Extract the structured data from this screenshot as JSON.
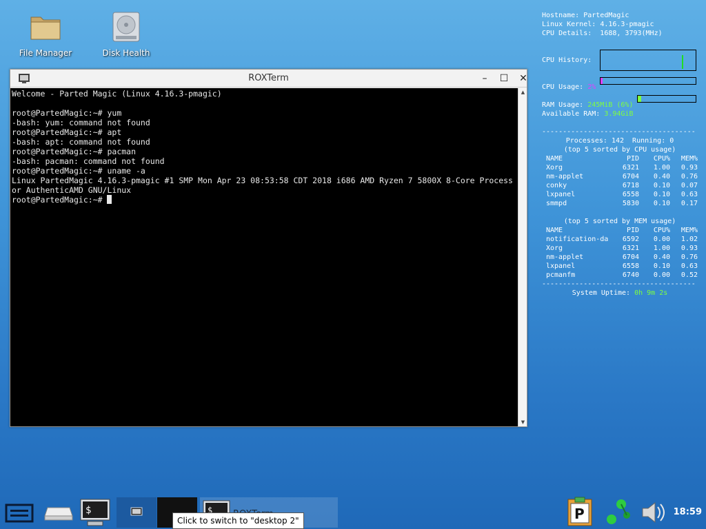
{
  "desktop_icons": [
    {
      "label": "File Manager"
    },
    {
      "label": "Disk Health"
    }
  ],
  "conky": {
    "hostname_label": "Hostname:",
    "hostname": "PartedMagic",
    "kernel_label": "Linux Kernel:",
    "kernel": "4.16.3-pmagic",
    "cpu_details_label": "CPU Details:",
    "cpu_details": "1688, 3793(MHz)",
    "cpu_history_label": "CPU History:",
    "cpu_usage_label": "CPU Usage:",
    "cpu_usage": "2%",
    "cpu_usage_fraction": 0.02,
    "ram_usage_label": "RAM Usage:",
    "ram_usage": "245MiB (6%)",
    "ram_usage_fraction": 0.06,
    "available_ram_label": "Available RAM:",
    "available_ram": "3.94GiB",
    "separator": "-------------------------------------",
    "processes_line": "Processes: 142  Running: 0",
    "cpu_sort_heading": "(top 5 sorted by CPU usage)",
    "mem_sort_heading": "(top 5 sorted by MEM usage)",
    "columns": [
      "NAME",
      "PID",
      "CPU%",
      "MEM%"
    ],
    "cpu_top": [
      [
        "Xorg",
        "6321",
        "1.00",
        "0.93"
      ],
      [
        "nm-applet",
        "6704",
        "0.40",
        "0.76"
      ],
      [
        "conky",
        "6718",
        "0.10",
        "0.07"
      ],
      [
        "lxpanel",
        "6558",
        "0.10",
        "0.63"
      ],
      [
        "smmpd",
        "5830",
        "0.10",
        "0.17"
      ]
    ],
    "mem_top": [
      [
        "notification-da",
        "6592",
        "0.00",
        "1.02"
      ],
      [
        "Xorg",
        "6321",
        "1.00",
        "0.93"
      ],
      [
        "nm-applet",
        "6704",
        "0.40",
        "0.76"
      ],
      [
        "lxpanel",
        "6558",
        "0.10",
        "0.63"
      ],
      [
        "pcmanfm",
        "6740",
        "0.00",
        "0.52"
      ]
    ],
    "uptime_label": "System Uptime:",
    "uptime": "0h 9m 2s"
  },
  "window": {
    "title": "ROXTerm",
    "minimize": "–",
    "maximize": "☐",
    "close": "✕"
  },
  "terminal": {
    "lines": [
      "Welcome - Parted Magic (Linux 4.16.3-pmagic)",
      "",
      "root@PartedMagic:~# yum",
      "-bash: yum: command not found",
      "root@PartedMagic:~# apt",
      "-bash: apt: command not found",
      "root@PartedMagic:~# pacman",
      "-bash: pacman: command not found",
      "root@PartedMagic:~# uname -a",
      "Linux PartedMagic 4.16.3-pmagic #1 SMP Mon Apr 23 08:53:58 CDT 2018 i686 AMD Ryzen 7 5800X 8-Core Process",
      "or AuthenticAMD GNU/Linux"
    ],
    "prompt": "root@PartedMagic:~# "
  },
  "taskbar": {
    "task_label": "ROXTerm",
    "tooltip": "Click to switch to \"desktop 2\"",
    "clock": "18:59",
    "pkg_letter": "P",
    "terminal_glyph": "$"
  },
  "colors": {
    "desktop_top": "#5fb0e6",
    "desktop_bottom": "#1f69b8",
    "conky_green": "#7fff3f",
    "conky_magenta": "#e040ff"
  }
}
